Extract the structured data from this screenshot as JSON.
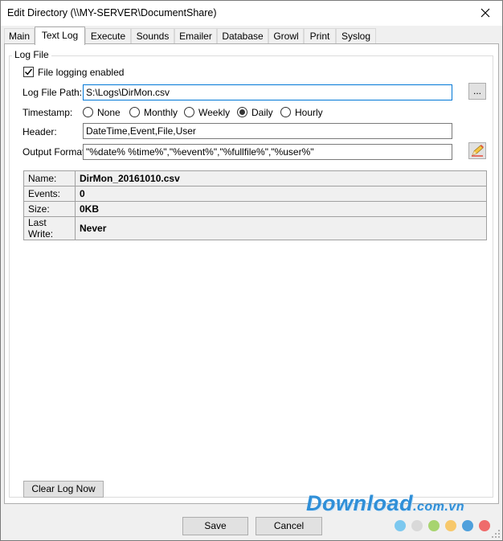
{
  "window": {
    "title": "Edit Directory (\\\\MY-SERVER\\DocumentShare)"
  },
  "tabs": [
    "Main",
    "Text Log",
    "Execute",
    "Sounds",
    "Emailer",
    "Database",
    "Growl",
    "Print",
    "Syslog"
  ],
  "active_tab": "Text Log",
  "log_file": {
    "group_title": "Log File",
    "logging_enabled_label": "File logging enabled",
    "logging_enabled": true,
    "path_label": "Log File Path:",
    "path_value": "S:\\Logs\\DirMon.csv",
    "browse_label": "...",
    "timestamp_label": "Timestamp:",
    "timestamp_options": [
      "None",
      "Monthly",
      "Weekly",
      "Daily",
      "Hourly"
    ],
    "timestamp_selected": "Daily",
    "header_label": "Header:",
    "header_value": "DateTime,Event,File,User",
    "format_label": "Output Format:",
    "format_value": "\"%date% %time%\",\"%event%\",\"%fullfile%\",\"%user%\""
  },
  "info": {
    "rows": [
      {
        "key": "Name:",
        "value": "DirMon_20161010.csv"
      },
      {
        "key": "Events:",
        "value": "0"
      },
      {
        "key": "Size:",
        "value": "0KB"
      },
      {
        "key": "Last Write:",
        "value": "Never"
      }
    ]
  },
  "clear_log_label": "Clear Log Now",
  "save_label": "Save",
  "cancel_label": "Cancel",
  "watermark": {
    "main": "Download",
    "suffix": ".com.vn"
  },
  "colors": {
    "accent": "#0078d7",
    "watermark": "#2f8fd8",
    "dots": [
      "#7cc8ef",
      "#d9d9d9",
      "#a7d46f",
      "#f7c86b",
      "#4fa0dc",
      "#ef6b6b"
    ]
  }
}
